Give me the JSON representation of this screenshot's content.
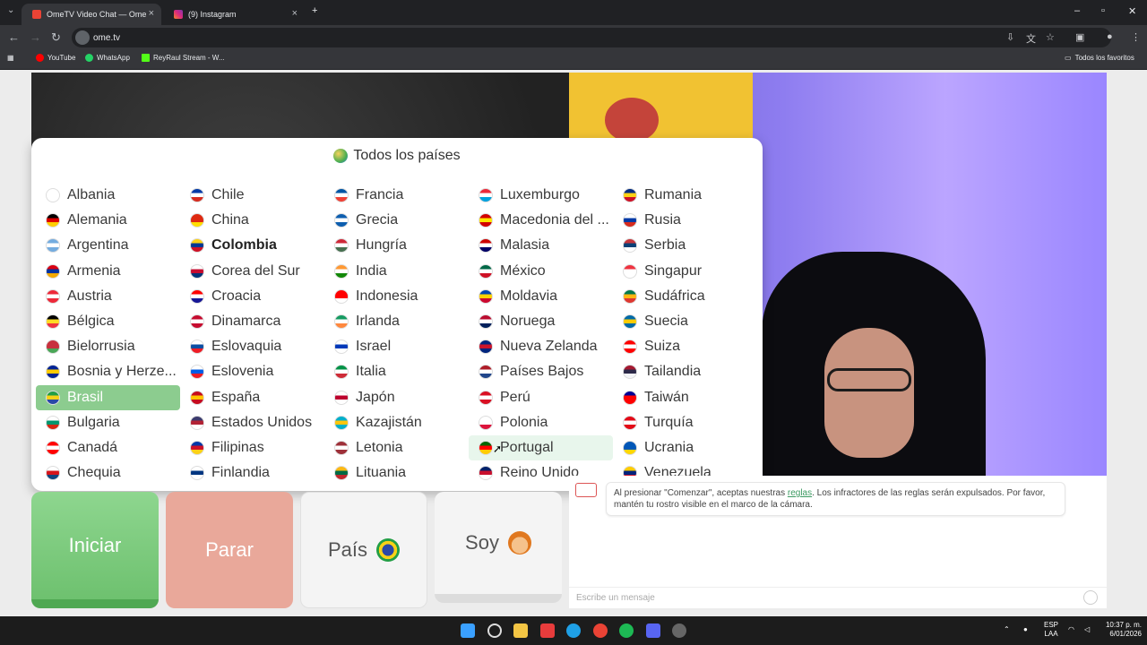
{
  "browser": {
    "tabs": [
      {
        "title": "OmeTV Video Chat — Ome",
        "active": true
      },
      {
        "title": "(9) Instagram",
        "active": false
      }
    ],
    "url": "ome.tv",
    "bookmarks": [
      "YouTube",
      "WhatsApp",
      "ReyRaul Stream - W..."
    ],
    "bookmarks_folder": "Todos los favoritos"
  },
  "country_dropdown": {
    "header": "Todos los países",
    "selected": "Brasil",
    "hovered": "Portugal",
    "bold": "Colombia",
    "columns": [
      [
        {
          "name": "Albania",
          "colors": [
            "#e41e20",
            "#8b0000"
          ]
        },
        {
          "name": "Alemania",
          "colors": [
            "#000000",
            "#dd0000",
            "#ffce00"
          ]
        },
        {
          "name": "Argentina",
          "colors": [
            "#74acdf",
            "#ffffff",
            "#74acdf"
          ]
        },
        {
          "name": "Armenia",
          "colors": [
            "#d90012",
            "#0033a0",
            "#f2a800"
          ]
        },
        {
          "name": "Austria",
          "colors": [
            "#ed2939",
            "#ffffff",
            "#ed2939"
          ]
        },
        {
          "name": "Bélgica",
          "colors": [
            "#000000",
            "#fdda24",
            "#ef3340"
          ]
        },
        {
          "name": "Bielorrusia",
          "colors": [
            "#c8313e",
            "#c8313e",
            "#4aa657"
          ]
        },
        {
          "name": "Bosnia y Herze...",
          "colors": [
            "#002395",
            "#fecb00",
            "#002395"
          ]
        },
        {
          "name": "Brasil",
          "colors": [
            "#229e45",
            "#f7d117",
            "#2b49a6"
          ]
        },
        {
          "name": "Bulgaria",
          "colors": [
            "#ffffff",
            "#00966e",
            "#d62612"
          ]
        },
        {
          "name": "Canadá",
          "colors": [
            "#ff0000",
            "#ffffff",
            "#ff0000"
          ]
        },
        {
          "name": "Chequia",
          "colors": [
            "#ffffff",
            "#d7141a",
            "#11457e"
          ]
        }
      ],
      [
        {
          "name": "Chile",
          "colors": [
            "#0039a6",
            "#ffffff",
            "#d52b1e"
          ]
        },
        {
          "name": "China",
          "colors": [
            "#de2910",
            "#de2910",
            "#ffde00"
          ]
        },
        {
          "name": "Colombia",
          "colors": [
            "#fcd116",
            "#003893",
            "#ce1126"
          ]
        },
        {
          "name": "Corea del Sur",
          "colors": [
            "#ffffff",
            "#c60c30",
            "#003478"
          ]
        },
        {
          "name": "Croacia",
          "colors": [
            "#ff0000",
            "#ffffff",
            "#171796"
          ]
        },
        {
          "name": "Dinamarca",
          "colors": [
            "#c60c30",
            "#ffffff",
            "#c60c30"
          ]
        },
        {
          "name": "Eslovaquia",
          "colors": [
            "#ffffff",
            "#0b4ea2",
            "#ee1c25"
          ]
        },
        {
          "name": "Eslovenia",
          "colors": [
            "#ffffff",
            "#005ce5",
            "#ed1c24"
          ]
        },
        {
          "name": "España",
          "colors": [
            "#c60b1e",
            "#ffc400",
            "#c60b1e"
          ]
        },
        {
          "name": "Estados Unidos",
          "colors": [
            "#3c3b6e",
            "#b22234",
            "#ffffff"
          ]
        },
        {
          "name": "Filipinas",
          "colors": [
            "#0038a8",
            "#ce1126",
            "#fcd116"
          ]
        },
        {
          "name": "Finlandia",
          "colors": [
            "#ffffff",
            "#003580",
            "#ffffff"
          ]
        }
      ],
      [
        {
          "name": "Francia",
          "colors": [
            "#0055a4",
            "#ffffff",
            "#ef4135"
          ]
        },
        {
          "name": "Grecia",
          "colors": [
            "#0d5eaf",
            "#ffffff",
            "#0d5eaf"
          ]
        },
        {
          "name": "Hungría",
          "colors": [
            "#ce2939",
            "#ffffff",
            "#477050"
          ]
        },
        {
          "name": "India",
          "colors": [
            "#ff9933",
            "#ffffff",
            "#138808"
          ]
        },
        {
          "name": "Indonesia",
          "colors": [
            "#ff0000",
            "#ff0000",
            "#ffffff"
          ]
        },
        {
          "name": "Irlanda",
          "colors": [
            "#169b62",
            "#ffffff",
            "#ff883e"
          ]
        },
        {
          "name": "Israel",
          "colors": [
            "#ffffff",
            "#0038b8",
            "#ffffff"
          ]
        },
        {
          "name": "Italia",
          "colors": [
            "#009246",
            "#ffffff",
            "#ce2b37"
          ]
        },
        {
          "name": "Japón",
          "colors": [
            "#ffffff",
            "#bc002d",
            "#ffffff"
          ]
        },
        {
          "name": "Kazajistán",
          "colors": [
            "#00afca",
            "#fec50c",
            "#00afca"
          ]
        },
        {
          "name": "Letonia",
          "colors": [
            "#9e3039",
            "#ffffff",
            "#9e3039"
          ]
        },
        {
          "name": "Lituania",
          "colors": [
            "#fdb913",
            "#006a44",
            "#c1272d"
          ]
        }
      ],
      [
        {
          "name": "Luxemburgo",
          "colors": [
            "#ed2939",
            "#ffffff",
            "#00a1de"
          ]
        },
        {
          "name": "Macedonia del ...",
          "colors": [
            "#d20000",
            "#ffe600",
            "#d20000"
          ]
        },
        {
          "name": "Malasia",
          "colors": [
            "#cc0001",
            "#ffffff",
            "#010066"
          ]
        },
        {
          "name": "México",
          "colors": [
            "#006847",
            "#ffffff",
            "#ce1126"
          ]
        },
        {
          "name": "Moldavia",
          "colors": [
            "#0046ae",
            "#ffd200",
            "#cc092f"
          ]
        },
        {
          "name": "Noruega",
          "colors": [
            "#ba0c2f",
            "#ffffff",
            "#00205b"
          ]
        },
        {
          "name": "Nueva Zelanda",
          "colors": [
            "#00247d",
            "#cc142b",
            "#00247d"
          ]
        },
        {
          "name": "Países Bajos",
          "colors": [
            "#ae1c28",
            "#ffffff",
            "#21468b"
          ]
        },
        {
          "name": "Perú",
          "colors": [
            "#d91023",
            "#ffffff",
            "#d91023"
          ]
        },
        {
          "name": "Polonia",
          "colors": [
            "#ffffff",
            "#ffffff",
            "#dc143c"
          ]
        },
        {
          "name": "Portugal",
          "colors": [
            "#006600",
            "#ff0000",
            "#ffcc00"
          ]
        },
        {
          "name": "Reino Unido",
          "colors": [
            "#012169",
            "#c8102e",
            "#ffffff"
          ]
        }
      ],
      [
        {
          "name": "Rumania",
          "colors": [
            "#002b7f",
            "#fcd116",
            "#ce1126"
          ]
        },
        {
          "name": "Rusia",
          "colors": [
            "#ffffff",
            "#0039a6",
            "#d52b1e"
          ]
        },
        {
          "name": "Serbia",
          "colors": [
            "#c6363c",
            "#0c4076",
            "#ffffff"
          ]
        },
        {
          "name": "Singapur",
          "colors": [
            "#ef3340",
            "#ffffff",
            "#ffffff"
          ]
        },
        {
          "name": "Sudáfrica",
          "colors": [
            "#007a4d",
            "#ffb612",
            "#de3831"
          ]
        },
        {
          "name": "Suecia",
          "colors": [
            "#006aa7",
            "#fecc00",
            "#006aa7"
          ]
        },
        {
          "name": "Suiza",
          "colors": [
            "#ff0000",
            "#ffffff",
            "#ff0000"
          ]
        },
        {
          "name": "Tailandia",
          "colors": [
            "#a51931",
            "#2d2a4a",
            "#f4f5f8"
          ]
        },
        {
          "name": "Taiwán",
          "colors": [
            "#000095",
            "#fe0000",
            "#fe0000"
          ]
        },
        {
          "name": "Turquía",
          "colors": [
            "#e30a17",
            "#ffffff",
            "#e30a17"
          ]
        },
        {
          "name": "Ucrania",
          "colors": [
            "#0057b7",
            "#0057b7",
            "#ffd700"
          ]
        },
        {
          "name": "Venezuela",
          "colors": [
            "#ffcc00",
            "#00247d",
            "#cf142b"
          ]
        }
      ]
    ]
  },
  "buttons": {
    "start": "Iniciar",
    "stop": "Parar",
    "country": "País",
    "me": "Soy"
  },
  "chat": {
    "message_part1": "Al presionar \"Comenzar\", aceptas nuestras ",
    "rules_link": "reglas",
    "message_part2": ". Los infractores de las reglas serán expulsados. Por favor, mantén tu rostro visible en el marco de la cámara.",
    "input_placeholder": "Escribe un mensaje"
  },
  "taskbar": {
    "lang_line1": "ESP",
    "lang_line2": "LAA",
    "time": "10:37 p. m.",
    "date": "6/01/2026"
  }
}
